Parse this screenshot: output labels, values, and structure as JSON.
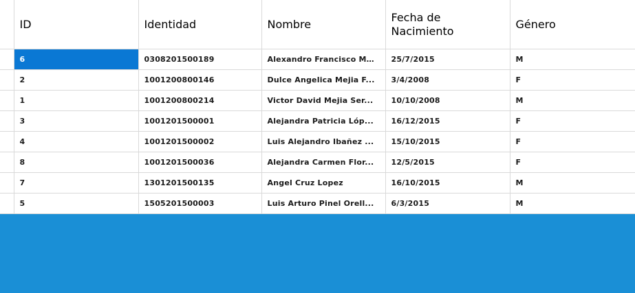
{
  "grid": {
    "columns": [
      "ID",
      "Identidad",
      "Nombre",
      "Fecha de Nacimiento",
      "Género"
    ],
    "selected_row": 0,
    "rows": [
      {
        "id": "6",
        "identidad": "0308201500189",
        "nombre": "Alexandro Francisco Mu...",
        "fecha": "25/7/2015",
        "genero": "M"
      },
      {
        "id": "2",
        "identidad": "1001200800146",
        "nombre": "Dulce Angelica Mejia F...",
        "fecha": "3/4/2008",
        "genero": "F"
      },
      {
        "id": "1",
        "identidad": "1001200800214",
        "nombre": "Victor David Mejia Ser...",
        "fecha": "10/10/2008",
        "genero": "M"
      },
      {
        "id": "3",
        "identidad": "1001201500001",
        "nombre": "Alejandra Patricia Lóp...",
        "fecha": "16/12/2015",
        "genero": "F"
      },
      {
        "id": "4",
        "identidad": "1001201500002",
        "nombre": "Luis Alejandro Ibañez ...",
        "fecha": "15/10/2015",
        "genero": "F"
      },
      {
        "id": "8",
        "identidad": "1001201500036",
        "nombre": "Alejandra Carmen Flor...",
        "fecha": "12/5/2015",
        "genero": "F"
      },
      {
        "id": "7",
        "identidad": "1301201500135",
        "nombre": "Angel  Cruz Lopez",
        "fecha": "16/10/2015",
        "genero": "M"
      },
      {
        "id": "5",
        "identidad": "1505201500003",
        "nombre": "Luis Arturo Pinel Orell...",
        "fecha": "6/3/2015",
        "genero": "M"
      }
    ]
  },
  "colors": {
    "selection": "#0a78d4",
    "pane_background": "#1a8fd6",
    "grid_lines": "#d9d9d9"
  }
}
